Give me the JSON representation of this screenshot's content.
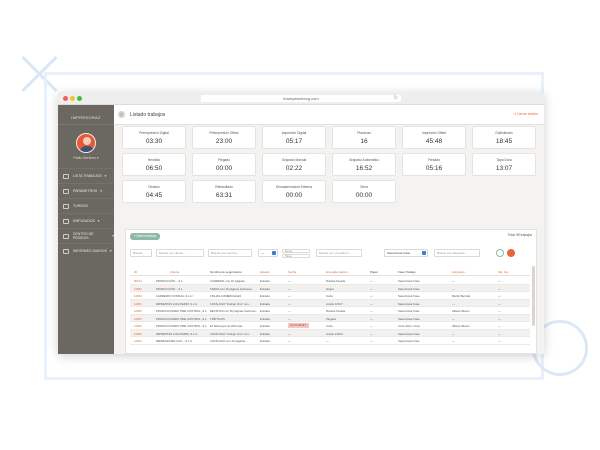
{
  "browser": {
    "url": "teamyewebxxg.com"
  },
  "sidebar": {
    "brand": "IMPRESORAZ",
    "user_name": "Pablo Berlines",
    "items": [
      {
        "label": "LISTA TRABAJOS",
        "chevron": true
      },
      {
        "label": "PARÁMETROS",
        "chevron": true
      },
      {
        "label": "TURNOS",
        "chevron": false
      },
      {
        "label": "EMPLEADOS",
        "chevron": true
      },
      {
        "label": "CENTRO DE PEDIDOS",
        "chevron": true
      },
      {
        "label": "INFORMES DIARIOS",
        "chevron": true
      }
    ]
  },
  "header": {
    "title": "Listado trabajos",
    "logout": "Cerrar sesión"
  },
  "stats": [
    {
      "label": "Preimpresión Digital",
      "value": "03:30"
    },
    {
      "label": "Preimpresión Offset",
      "value": "23:00"
    },
    {
      "label": "Impresión Digital",
      "value": "05:17"
    },
    {
      "label": "Planchas",
      "value": "16"
    },
    {
      "label": "Impresión Offset",
      "value": "45:48"
    },
    {
      "label": "Guillotinado",
      "value": "18:45"
    },
    {
      "label": "Hendido",
      "value": "06:50"
    },
    {
      "label": "Plegado",
      "value": "00:00"
    },
    {
      "label": "Grapado Manual",
      "value": "02:22"
    },
    {
      "label": "Grapado Automático",
      "value": "16:52"
    },
    {
      "label": "Fresado",
      "value": "05:16"
    },
    {
      "label": "Tapa Dura",
      "value": "13:07"
    },
    {
      "label": "División",
      "value": "04:45"
    },
    {
      "label": "Retractilado",
      "value": "63:31"
    },
    {
      "label": "Encuadernación Externa",
      "value": "00:00"
    },
    {
      "label": "Otros",
      "value": "00:00"
    }
  ],
  "table": {
    "new_button": "+ Nuevo trabajo",
    "total": "Total: 59 trabajos",
    "filters": {
      "id": "Buscar",
      "client": "Buscar por cliente...",
      "name": "Buscar por nombre...",
      "status": "—",
      "date_from": "Desde",
      "date_to": "Hasta",
      "deliver": "Buscar por encuadern...",
      "phase": "Seleccionar Fase",
      "assigned": "Buscar por asignado...",
      "extra": "Buscar por ..."
    },
    "headers": {
      "id": "ID",
      "client": "Cliente",
      "name": "Nombre de seguimiento",
      "status": "Estado",
      "date": "Fecha",
      "deliver": "Encuadernación",
      "paper": "Papel",
      "phase": "Fase Trabajo",
      "assigned": "Asignado",
      "extra": "Mq. Ing."
    },
    "rows": [
      {
        "id": "80131",
        "client": "PRODUCCIÓN... S.L.",
        "name": "CARRETEL con 16 páginas...",
        "status": "Entrada",
        "date": "—",
        "deliver": "Rústica fresada",
        "paper": "—",
        "phase": "Seleccionar Fase",
        "assigned": "—",
        "extra": "—"
      },
      {
        "id": "12681",
        "client": "PRODUCCIÓN... S.L.",
        "name": "TARIFA con 16 páginas interiores...",
        "status": "Entrada",
        "date": "—",
        "deliver": "Grapa",
        "paper": "—",
        "phase": "Seleccionar Fase",
        "assigned": "—",
        "extra": "—"
      },
      {
        "id": "12650",
        "client": "CARREIRO CONSULL S.L.U.",
        "name": "FICHAS COMERCIALES",
        "status": "Entrada",
        "date": "—",
        "deliver": "Corte",
        "paper": "—",
        "phase": "Seleccionar Fase",
        "assigned": "Martín Berrolla",
        "extra": "—"
      },
      {
        "id": "12651",
        "client": "IMPRENTAS LOGI FERRI, S.L.U.",
        "name": "CATÁLOGO \"Código Vino\" con...",
        "status": "Entrada",
        "date": "—",
        "deliver": "cosido 1/8/17",
        "paper": "—",
        "phase": "Seleccionar Fase",
        "assigned": "—",
        "extra": "—"
      },
      {
        "id": "12650",
        "client": "PRODUCCIONES TIME CONTROL, S.L.",
        "name": "REVISTAS con 56 páginas interiores...",
        "status": "Entrada",
        "date": "—",
        "deliver": "Rústica fresada",
        "paper": "—",
        "phase": "Seleccionar Fase",
        "assigned": "Alberto Bueno",
        "extra": "—"
      },
      {
        "id": "12653",
        "client": "PRODUCCIONES TIME CONTROL, S.L.",
        "name": "TRÍPTICOS",
        "status": "Entrada",
        "date": "—",
        "deliver": "Plegado",
        "paper": "—",
        "phase": "Seleccionar Fase",
        "assigned": "—",
        "extra": "—"
      },
      {
        "id": "12653",
        "client": "PRODUCCIONES TIME CONTROL, S.L.",
        "name": "El Telescopio de 184 total...",
        "status": "Entrada",
        "date": "01-07-2019 T",
        "deliver": "Corte",
        "paper": "—",
        "phase": "Corte (Rptr. corte)",
        "assigned": "Alberto Bueno",
        "extra": "—"
      },
      {
        "id": "12652",
        "client": "IMPRENTAS LOGI FERRI, S.L.U.",
        "name": "CATÁLOGO \"Código Vino\" con...",
        "status": "Entrada",
        "date": "—",
        "deliver": "cosido 1/8/23",
        "paper": "—",
        "phase": "Seleccionar Fase",
        "assigned": "—",
        "extra": "—"
      },
      {
        "id": "12644",
        "client": "IMPRESIONES CAS... S.L.U.",
        "name": "CATÁLOGO con 16 páginas...",
        "status": "Entrada",
        "date": "—",
        "deliver": "—",
        "paper": "—",
        "phase": "Seleccionar Fase",
        "assigned": "—",
        "extra": "—"
      }
    ]
  },
  "colors": {
    "accent": "#e8663a",
    "sidebar": "#6b6862",
    "new_button": "#8fb8a6"
  }
}
